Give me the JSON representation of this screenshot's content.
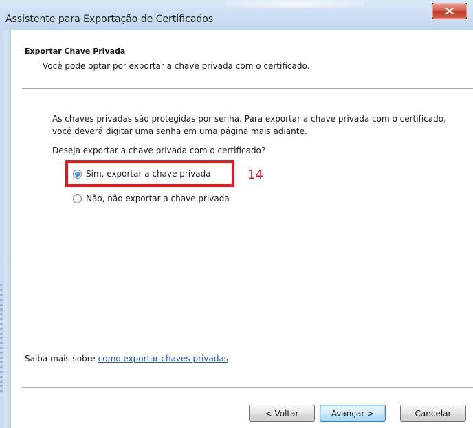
{
  "window": {
    "title": "Assistente para Exportação de Certificados"
  },
  "header": {
    "title": "Exportar Chave Privada",
    "subtitle": "Você pode optar por exportar a chave privada com o certificado."
  },
  "body": {
    "description": "As chaves privadas são protegidas por senha. Para exportar a chave privada com o certificado, você deverá digitar uma senha em uma página mais adiante.",
    "question": "Deseja exportar a chave privada com o certificado?",
    "options": [
      {
        "label": "Sim, exportar a chave privada",
        "selected": true
      },
      {
        "label": "Não, não exportar a chave privada",
        "selected": false
      }
    ],
    "annotation": "14",
    "annotation_color": "#e01b22"
  },
  "footer": {
    "learn_more_prefix": "Saiba mais sobre ",
    "learn_more_link": "como exportar chaves privadas"
  },
  "buttons": {
    "back": "< Voltar",
    "next": "Avançar >",
    "cancel": "Cancelar"
  },
  "icons": {
    "close": "close-icon"
  }
}
